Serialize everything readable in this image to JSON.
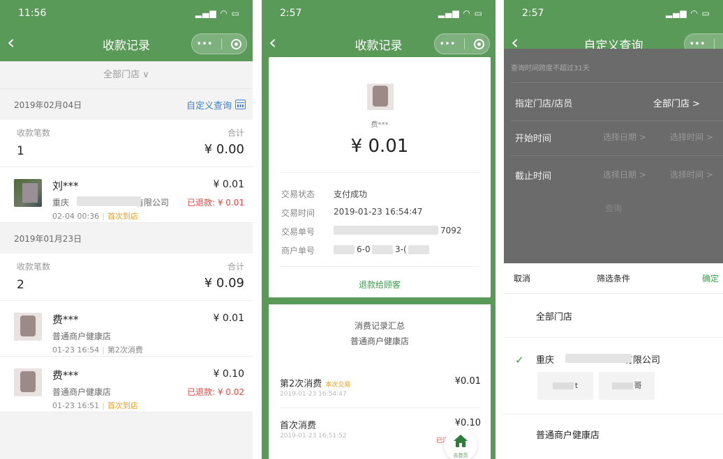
{
  "screen1": {
    "status_time": "11:56",
    "nav_title": "收款记录",
    "store_filter": "全部门店 ∨",
    "groups": [
      {
        "date": "2019年02月04日",
        "custom_query": "自定义查询",
        "count_label": "收款笔数",
        "count_value": "1",
        "total_label": "合计",
        "total_value": "¥ 0.00",
        "records": [
          {
            "name": "刘***",
            "shop": "重庆",
            "shop_suffix": "有限公司",
            "time": "02-04 00:36",
            "tag": "首次到店",
            "amount": "¥ 0.01",
            "refund": "已退款: ¥ 0.01"
          }
        ]
      },
      {
        "date": "2019年01月23日",
        "count_label": "收款笔数",
        "count_value": "2",
        "total_label": "合计",
        "total_value": "¥ 0.09",
        "records": [
          {
            "name": "费***",
            "shop": "普通商户健康店",
            "time": "01-23 16:54",
            "tag": "第2次消费",
            "amount": "¥ 0.01",
            "refund": ""
          },
          {
            "name": "费***",
            "shop": "普通商户健康店",
            "time": "01-23 16:51",
            "tag": "首次到店",
            "amount": "¥ 0.10",
            "refund": "已退款: ¥ 0.02"
          }
        ]
      }
    ]
  },
  "screen2": {
    "status_time": "2:57",
    "nav_title": "收款记录",
    "payer_name": "费***",
    "amount": "¥ 0.01",
    "fields": [
      {
        "label": "交易状态",
        "value": "支付成功"
      },
      {
        "label": "交易时间",
        "value": "2019-01-23 16:54:47"
      },
      {
        "label": "交易单号",
        "value": "7092"
      },
      {
        "label": "商户单号",
        "value": "6-0",
        "value2": "3-("
      }
    ],
    "refund_button": "退款给顾客",
    "summary_title": "消费记录汇总",
    "summary_shop": "普通商户健康店",
    "items": [
      {
        "title": "第2次消费",
        "tag": "本次交易",
        "date": "2019-01-23 16:54:47",
        "amount": "¥0.01"
      },
      {
        "title": "首次消费",
        "tag": "",
        "date": "2019-01-23 16:51:52",
        "amount": "¥0.10",
        "refund": "已退"
      }
    ],
    "home_label": "去首页"
  },
  "screen3": {
    "status_time": "2:57",
    "nav_title": "自定义查询",
    "hint": "查询时间跨度不超过31天",
    "rows": [
      {
        "label": "指定门店/店员",
        "value": "全部门店 >"
      },
      {
        "label": "开始时间",
        "date": "选择日期 >",
        "time": "选择时间 >"
      },
      {
        "label": "截止时间",
        "date": "选择日期 >",
        "time": "选择时间 >"
      }
    ],
    "query_button": "查询",
    "sheet": {
      "cancel": "取消",
      "title": "筛选条件",
      "confirm": "确定",
      "opt_all": "全部门店",
      "opt_selected": "重庆",
      "opt_selected_suffix": "有限公司",
      "chip1": "t",
      "chip2": "哥",
      "opt_other": "普通商户健康店"
    }
  },
  "colors": {
    "brand_green": "#5a9a59",
    "link_blue": "#3c7fd6",
    "refund_red": "#e8463c",
    "tag_orange": "#f0a020"
  }
}
